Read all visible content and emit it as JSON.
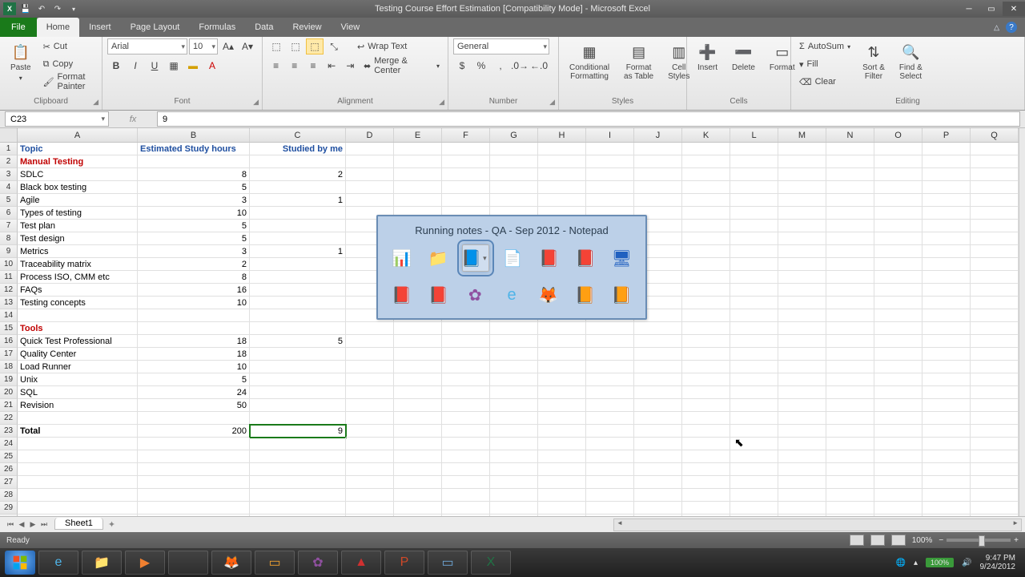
{
  "titlebar": {
    "title": "Testing Course Effort Estimation  [Compatibility Mode] - Microsoft Excel"
  },
  "ribbon_tabs": {
    "file": "File",
    "tabs": [
      "Home",
      "Insert",
      "Page Layout",
      "Formulas",
      "Data",
      "Review",
      "View"
    ],
    "active": "Home"
  },
  "ribbon": {
    "clipboard": {
      "paste": "Paste",
      "cut": "Cut",
      "copy": "Copy",
      "fp": "Format Painter",
      "label": "Clipboard"
    },
    "font": {
      "name": "Arial",
      "size": "10",
      "label": "Font"
    },
    "alignment": {
      "wrap": "Wrap Text",
      "merge": "Merge & Center",
      "label": "Alignment"
    },
    "number": {
      "format": "General",
      "label": "Number"
    },
    "styles": {
      "cond": "Conditional\nFormatting",
      "fmt": "Format\nas Table",
      "cell": "Cell\nStyles",
      "label": "Styles"
    },
    "cells": {
      "ins": "Insert",
      "del": "Delete",
      "fmt": "Format",
      "label": "Cells"
    },
    "editing": {
      "sum": "AutoSum",
      "fill": "Fill",
      "clear": "Clear",
      "sort": "Sort &\nFilter",
      "find": "Find &\nSelect",
      "label": "Editing"
    }
  },
  "namebox": "C23",
  "formula": "9",
  "columns": [
    "A",
    "B",
    "C",
    "D",
    "E",
    "F",
    "G",
    "H",
    "I",
    "J",
    "K",
    "L",
    "M",
    "N",
    "O",
    "P",
    "Q"
  ],
  "rowcount": 30,
  "sheet": {
    "headers": {
      "a": "Topic",
      "b": "Estimated Study hours",
      "c": "Studied by me"
    },
    "section1": "Manual Testing",
    "section2": "Tools",
    "total": "Total",
    "rows": [
      {
        "r": 3,
        "a": "SDLC",
        "b": "8",
        "c": "2"
      },
      {
        "r": 4,
        "a": "Black box testing",
        "b": "5",
        "c": ""
      },
      {
        "r": 5,
        "a": "Agile",
        "b": "3",
        "c": "1"
      },
      {
        "r": 6,
        "a": "Types of testing",
        "b": "10",
        "c": ""
      },
      {
        "r": 7,
        "a": "Test plan",
        "b": "5",
        "c": ""
      },
      {
        "r": 8,
        "a": "Test design",
        "b": "5",
        "c": ""
      },
      {
        "r": 9,
        "a": "Metrics",
        "b": "3",
        "c": "1"
      },
      {
        "r": 10,
        "a": "Traceability matrix",
        "b": "2",
        "c": ""
      },
      {
        "r": 11,
        "a": "Process ISO, CMM etc",
        "b": "8",
        "c": ""
      },
      {
        "r": 12,
        "a": "FAQs",
        "b": "16",
        "c": ""
      },
      {
        "r": 13,
        "a": "Testing concepts",
        "b": "10",
        "c": ""
      },
      {
        "r": 16,
        "a": "Quick Test Professional",
        "b": "18",
        "c": "5"
      },
      {
        "r": 17,
        "a": "Quality Center",
        "b": "18",
        "c": ""
      },
      {
        "r": 18,
        "a": "Load Runner",
        "b": "10",
        "c": ""
      },
      {
        "r": 19,
        "a": "Unix",
        "b": "5",
        "c": ""
      },
      {
        "r": 20,
        "a": "SQL",
        "b": "24",
        "c": ""
      },
      {
        "r": 21,
        "a": "Revision",
        "b": "50",
        "c": ""
      }
    ],
    "totals": {
      "b": "200",
      "c": "9"
    }
  },
  "sheettab": "Sheet1",
  "status": {
    "ready": "Ready",
    "zoom": "100%"
  },
  "alttab": {
    "title": "Running notes - QA - Sep 2012 - Notepad"
  },
  "taskbar": {
    "time": "9:47 PM",
    "date": "9/24/2012"
  }
}
